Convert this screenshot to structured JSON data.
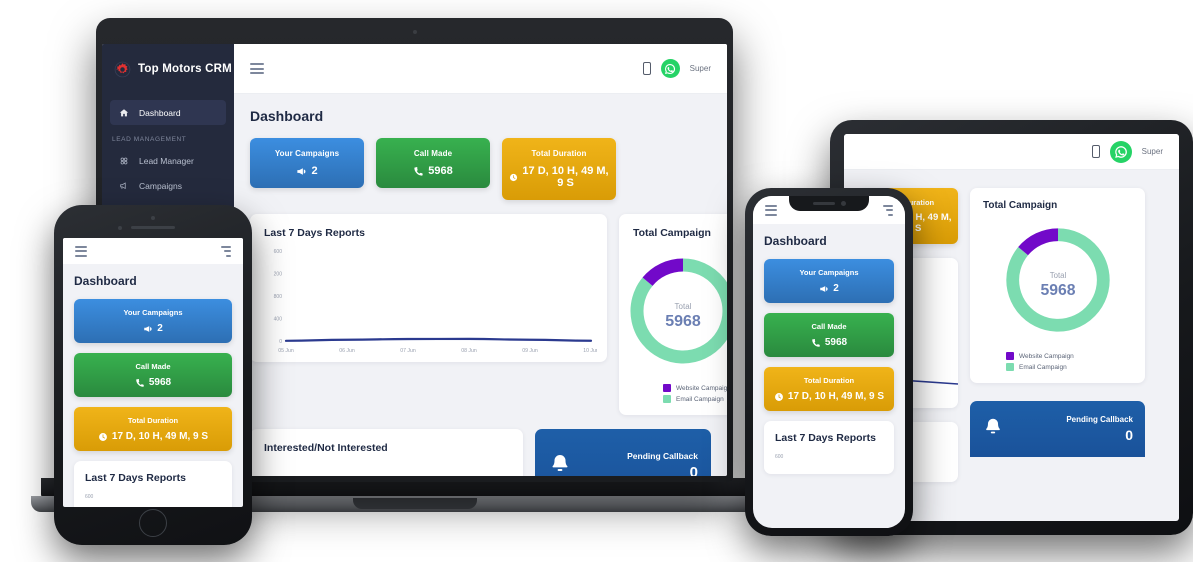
{
  "brand": {
    "name": "Top Motors CRM",
    "logo_icon": "gear-icon",
    "logo_color": "#e03131"
  },
  "sidebar": {
    "primary": [
      {
        "label": "Dashboard",
        "icon": "home-icon",
        "active": true
      }
    ],
    "section_header": "LEAD MANAGEMENT",
    "items": [
      {
        "label": "Lead Manager",
        "icon": "grid-icon"
      },
      {
        "label": "Campaigns",
        "icon": "megaphone-icon"
      }
    ]
  },
  "topbar": {
    "menu_icon": "hamburger-icon",
    "mobile_icon": "mobile-phone-icon",
    "whatsapp_icon": "whatsapp-icon",
    "whatsapp_color": "#25d366",
    "user_label": "Super"
  },
  "page": {
    "title": "Dashboard"
  },
  "kpis": [
    {
      "label": "Your Campaigns",
      "value": "2",
      "icon": "megaphone-icon",
      "color": "#3c8ee0",
      "key": "campaigns"
    },
    {
      "label": "Call Made",
      "value": "5968",
      "icon": "phone-icon",
      "color": "#38b14f",
      "key": "calls"
    },
    {
      "label": "Total Duration",
      "value": "17 D, 10 H, 49 M, 9 S",
      "icon": "clock-icon",
      "color": "#f0b419",
      "key": "duration"
    }
  ],
  "cards": {
    "reports_title": "Last 7 Days Reports",
    "campaign_title": "Total Campaign",
    "interest_title": "Interested/Not Interested",
    "menu_icon": "more-menu-icon"
  },
  "callback": {
    "label": "Pending Callback",
    "value": "0",
    "icon": "bell-icon",
    "color": "#1e5fa8"
  },
  "donut": {
    "center_label": "Total",
    "center_value": "5968",
    "website_color": "#7209c9",
    "email_color": "#7cdcb0"
  },
  "chart_data": [
    {
      "type": "line",
      "title": "Last 7 Days Reports",
      "x": [
        "05 Jun",
        "06 Jun",
        "07 Jun",
        "08 Jun",
        "09 Jun",
        "10 Jun"
      ],
      "values": [
        2,
        14,
        22,
        24,
        14,
        3
      ],
      "ytick_labels": [
        "600",
        "200",
        "800",
        "400",
        "0"
      ],
      "ytick_values": [
        600,
        200,
        800,
        400,
        0
      ],
      "ylim": [
        0,
        1000
      ],
      "xlabel": "",
      "ylabel": "",
      "grid": false,
      "line_color": "#2b3a8f",
      "legend": "none"
    },
    {
      "type": "pie",
      "subtype": "donut",
      "title": "Total Campaign",
      "labels": [
        "Website Campaign",
        "Email Campaign"
      ],
      "values": [
        14,
        86
      ],
      "colors": [
        "#7209c9",
        "#7cdcb0"
      ],
      "center_label": "Total",
      "center_value": "5968",
      "legend": "bottom-left"
    }
  ],
  "mobile_axis_label": "600"
}
